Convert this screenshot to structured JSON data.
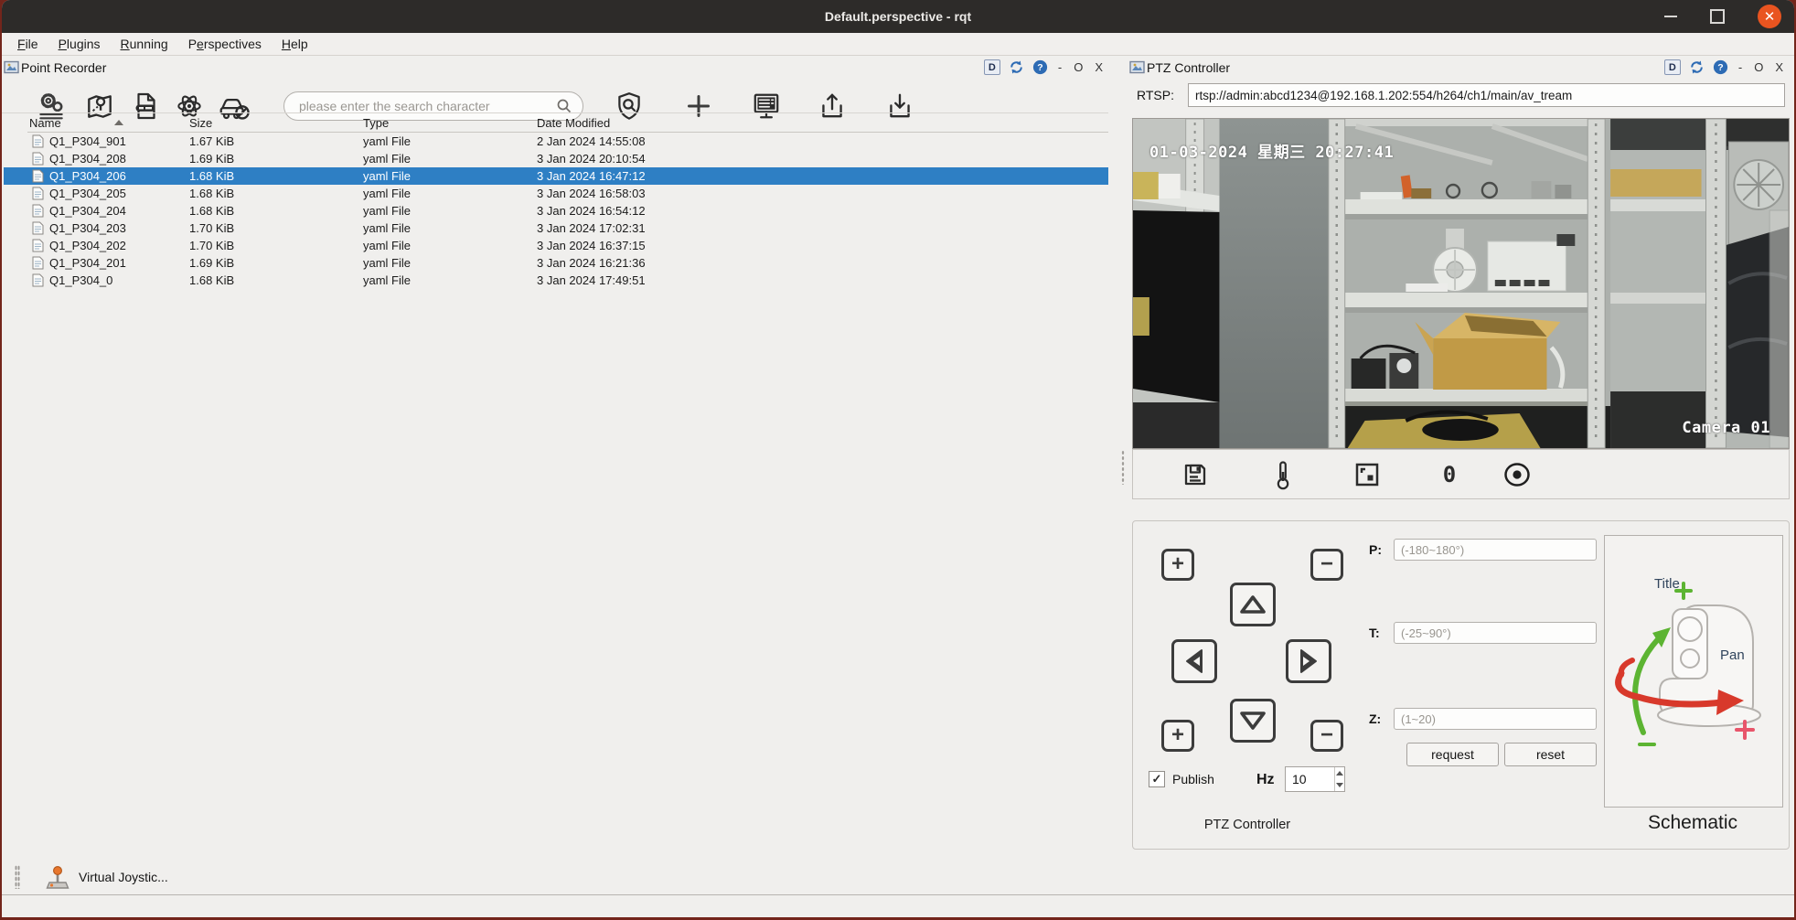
{
  "window": {
    "title": "Default.perspective - rqt",
    "controls": {
      "minimize": "–",
      "maximize": "□",
      "close": "✕"
    }
  },
  "menu": {
    "items": [
      {
        "label": "File",
        "mnemonic_index": 0
      },
      {
        "label": "Plugins",
        "mnemonic_index": 0
      },
      {
        "label": "Running",
        "mnemonic_index": 0
      },
      {
        "label": "Perspectives",
        "mnemonic_index": 1
      },
      {
        "label": "Help",
        "mnemonic_index": 0
      }
    ]
  },
  "point_recorder": {
    "title": "Point Recorder",
    "panel_buttons": {
      "d": "D",
      "minimize": "-",
      "float": "O",
      "close": "X"
    },
    "toolbar": {
      "search_placeholder": "please enter the search character",
      "icons": [
        "settings",
        "map-point",
        "yaml-file",
        "atom",
        "car-disabled",
        "shield-search",
        "add",
        "display-list",
        "upload",
        "download"
      ]
    },
    "table": {
      "columns": [
        "Name",
        "Size",
        "Type",
        "Date Modified"
      ],
      "sort": {
        "column": "Name",
        "direction": "asc"
      },
      "selected_index": 2,
      "rows": [
        {
          "name": "Q1_P304_901",
          "size": "1.67 KiB",
          "type": "yaml File",
          "modified": "2 Jan 2024 14:55:08"
        },
        {
          "name": "Q1_P304_208",
          "size": "1.69 KiB",
          "type": "yaml File",
          "modified": "3 Jan 2024 20:10:54"
        },
        {
          "name": "Q1_P304_206",
          "size": "1.68 KiB",
          "type": "yaml File",
          "modified": "3 Jan 2024 16:47:12"
        },
        {
          "name": "Q1_P304_205",
          "size": "1.68 KiB",
          "type": "yaml File",
          "modified": "3 Jan 2024 16:58:03"
        },
        {
          "name": "Q1_P304_204",
          "size": "1.68 KiB",
          "type": "yaml File",
          "modified": "3 Jan 2024 16:54:12"
        },
        {
          "name": "Q1_P304_203",
          "size": "1.70 KiB",
          "type": "yaml File",
          "modified": "3 Jan 2024 17:02:31"
        },
        {
          "name": "Q1_P304_202",
          "size": "1.70 KiB",
          "type": "yaml File",
          "modified": "3 Jan 2024 16:37:15"
        },
        {
          "name": "Q1_P304_201",
          "size": "1.69 KiB",
          "type": "yaml File",
          "modified": "3 Jan 2024 16:21:36"
        },
        {
          "name": "Q1_P304_0",
          "size": "1.68 KiB",
          "type": "yaml File",
          "modified": "3 Jan 2024 17:49:51"
        }
      ]
    }
  },
  "ptz": {
    "title": "PTZ Controller",
    "panel_buttons": {
      "d": "D",
      "minimize": "-",
      "float": "O",
      "close": "X"
    },
    "rtsp_label": "RTSP:",
    "rtsp_value": "rtsp://admin:abcd1234@192.168.1.202:554/h264/ch1/main/av_tream",
    "video": {
      "timestamp": "01-03-2024 星期三 20:27:41",
      "camera_label": "Camera 01",
      "counter": "0"
    },
    "controls": {
      "publish_label": "Publish",
      "publish_checked": true,
      "check_glyph": "✓",
      "hz_label": "Hz",
      "hz_value": "10",
      "p_label": "P:",
      "p_placeholder": "(-180~180°)",
      "t_label": "T:",
      "t_placeholder": "(-25~90°)",
      "z_label": "Z:",
      "z_placeholder": "(1~20)",
      "request_label": "request",
      "reset_label": "reset",
      "group_caption": "PTZ Controller",
      "zoom_in_glyph": "+",
      "zoom_out_glyph": "−"
    },
    "schematic": {
      "tilt_label": "Title",
      "pan_label": "Pan",
      "caption": "Schematic",
      "tilt_color": "#5cb432",
      "pan_color": "#d8392b"
    }
  },
  "statusbar": {
    "joystick_label": "Virtual Joystic..."
  },
  "colors": {
    "selection": "#2e7fc4",
    "close_button": "#e95420",
    "titlebar": "#2d2b29",
    "panel_bg": "#f0efed",
    "desktop_edge": "#73251b"
  }
}
